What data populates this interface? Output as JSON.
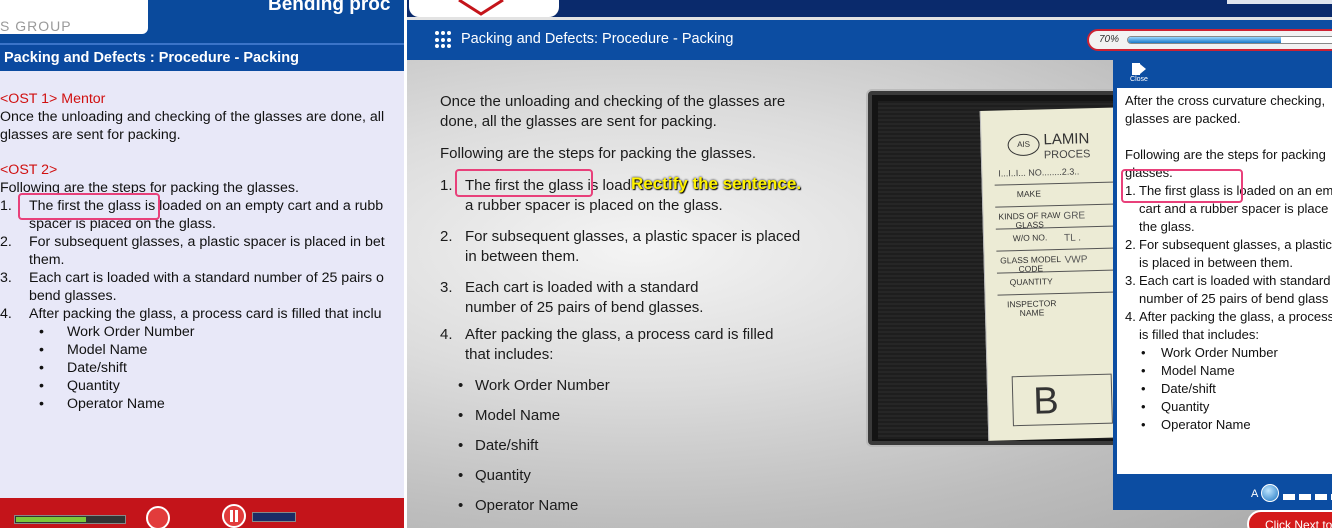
{
  "left_window": {
    "logo_text": "S GROUP",
    "title": "Bending proc",
    "subtitle": "Packing and Defects : Procedure - Packing",
    "ost1_label": "<OST 1> Mentor",
    "ost1_text_1": "Once the unloading  and checking of the glasses are done, all",
    "ost1_text_2": "glasses are sent for packing.",
    "ost2_label": "<OST 2>",
    "ost2_intro": "Following  are the steps for packing the glasses.",
    "steps": [
      {
        "num": "1.",
        "lines": [
          "The first the glass is loaded on an empty cart and a rubb",
          "spacer is placed on the glass."
        ]
      },
      {
        "num": "2.",
        "lines": [
          "For subsequent glasses, a plastic spacer is placed in bet",
          "them."
        ]
      },
      {
        "num": "3.",
        "lines": [
          "Each cart is loaded with a standard number of 25 pairs o",
          "bend glasses."
        ]
      },
      {
        "num": "4.",
        "lines": [
          "After packing the glass, a process card is filled that inclu"
        ]
      }
    ],
    "bullets": [
      "Work Order Number",
      "Model  Name",
      "Date/shift",
      "Quantity",
      "Operator Name"
    ],
    "bullet_char": "•"
  },
  "main_window": {
    "title": "Packing and Defects: Procedure - Packing",
    "progress_label": "70%",
    "progress_value": 0.7,
    "intro_1": "Once the unloading and checking of the glasses are",
    "intro_2": "done, all the glasses are sent for packing.",
    "steps_intro": "Following are the steps for packing the glasses.",
    "steps": [
      {
        "num": "1.",
        "lines": [
          "The first the glass is load",
          "a rubber spacer is placed on the glass."
        ]
      },
      {
        "num": "2.",
        "lines": [
          "For subsequent glasses, a plastic spacer is placed",
          "in between them."
        ]
      },
      {
        "num": "3.",
        "lines": [
          "Each cart is loaded with a standard",
          "number of 25 pairs of bend glasses."
        ]
      },
      {
        "num": "4.",
        "lines": [
          "After packing the glass, a process card is filled",
          "that includes:"
        ]
      }
    ],
    "bullets": [
      "Work Order Number",
      "Model Name",
      "Date/shift",
      "Quantity",
      "Operator Name"
    ],
    "bullet_char": "•",
    "annotation": "Rectify the sentence.",
    "card": {
      "ais": "AIS",
      "header": "LAMIN",
      "process": "PROCES",
      "number": "I...I..I... NO........2.3..",
      "rows": [
        {
          "label": "MAKE",
          "value": ""
        },
        {
          "label": "KINDS OF RAW GLASS",
          "value": "GRE"
        },
        {
          "label": "W/O NO.",
          "value": "TL ."
        },
        {
          "label": "GLASS MODEL CODE",
          "value": "VWP"
        },
        {
          "label": "QUANTITY",
          "value": ""
        },
        {
          "label": "INSPECTOR NAME",
          "value": ""
        }
      ],
      "big_letter": "B"
    }
  },
  "side_panel": {
    "close_label": "Close",
    "text_1": "After the cross curvature checking,",
    "text_2": "glasses are packed.",
    "steps_intro_1": "Following are the steps for packing",
    "steps_intro_2": "glasses.",
    "steps": [
      {
        "num": "1.",
        "lines": [
          "The first glass is loaded on an em",
          "cart and a rubber spacer is place",
          "the glass."
        ]
      },
      {
        "num": "2.",
        "lines": [
          "For subsequent glasses, a plastic",
          "is placed in between them."
        ]
      },
      {
        "num": "3.",
        "lines": [
          "Each cart is loaded with standard",
          "number of 25 pairs of bend glass"
        ]
      },
      {
        "num": "4.",
        "lines": [
          "After packing the glass, a process",
          "is filled that includes:"
        ]
      }
    ],
    "bullets": [
      "Work Order Number",
      "Model Name",
      "Date/shift",
      "Quantity",
      "Operator Name"
    ],
    "bullet_char": "•",
    "font_label": "A"
  },
  "next_button": "Click Next to",
  "colors": {
    "brand_blue": "#0c4da2",
    "brand_red": "#c4141a",
    "highlight_pink": "#e8407a",
    "annotation_yellow": "#fff200"
  }
}
